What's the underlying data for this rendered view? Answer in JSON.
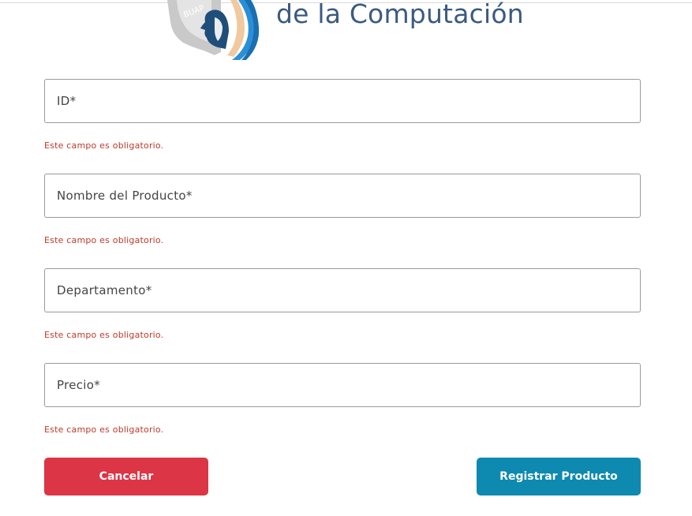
{
  "header": {
    "logo_text": "de la Computación",
    "emblem_text": "BUAP"
  },
  "form": {
    "fields": [
      {
        "label": "ID*",
        "error": "Este campo es obligatorio."
      },
      {
        "label": "Nombre del Producto*",
        "error": "Este campo es obligatorio."
      },
      {
        "label": "Departamento*",
        "error": "Este campo es obligatorio."
      },
      {
        "label": "Precio*",
        "error": "Este campo es obligatorio."
      }
    ]
  },
  "actions": {
    "cancel_label": "Cancelar",
    "submit_label": "Registrar Producto"
  },
  "colors": {
    "error": "#c0392b",
    "cancel": "#dc3545",
    "submit": "#0e89b0",
    "logo_text": "#3b5a7f"
  }
}
